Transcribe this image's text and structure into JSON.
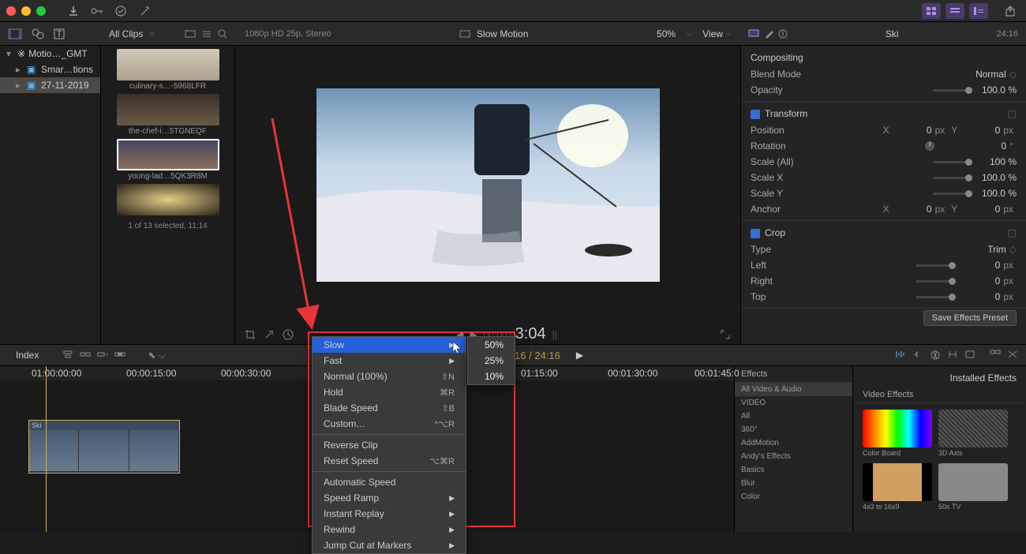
{
  "toolbar": {
    "import": "↓",
    "keyword": "⌁",
    "share": "⤴"
  },
  "browser_header": {
    "dropdown": "All Clips",
    "format": "1080p HD 25p, Stereo"
  },
  "viewer": {
    "title": "Slow Motion",
    "zoom": "50%",
    "view": "View",
    "time_display": "00:00:03;04",
    "time_goto": "3:04"
  },
  "inspector": {
    "title": "Ski",
    "duration": "24:16",
    "sections": {
      "compositing": "Compositing",
      "blend_mode_label": "Blend Mode",
      "blend_mode_value": "Normal",
      "opacity_label": "Opacity",
      "opacity_value": "100.0 %",
      "transform": "Transform",
      "position_label": "Position",
      "position_x": "0",
      "position_y": "0",
      "rotation_label": "Rotation",
      "rotation_value": "0",
      "scale_all_label": "Scale (All)",
      "scale_all_value": "100 %",
      "scale_x_label": "Scale X",
      "scale_x_value": "100.0 %",
      "scale_y_label": "Scale Y",
      "scale_y_value": "100.0 %",
      "anchor_label": "Anchor",
      "anchor_x": "0",
      "anchor_y": "0",
      "crop": "Crop",
      "type_label": "Type",
      "type_value": "Trim",
      "left_label": "Left",
      "left_value": "0",
      "right_label": "Right",
      "right_value": "0",
      "top_label": "Top",
      "top_value": "0",
      "px": "px",
      "deg": "°",
      "x_label": "X",
      "y_label": "Y"
    },
    "save_preset": "Save Effects Preset"
  },
  "tree": {
    "item1": "Motio…_GMT",
    "item2": "Smar…tions",
    "item3": "27-11-2019"
  },
  "clips": {
    "c1": "culinary-s…-5968LFR",
    "c2": "the-chef-i…5TGNEQF",
    "c3": "young-lad…5QK3R8M",
    "footer": "1 of 13 selected, 11;14"
  },
  "timeline": {
    "index": "Index",
    "time": "24:16 / 24:16",
    "marks": [
      "01:00:00:00",
      "00:00:15:00",
      "00:00:30:00",
      "01:15:00",
      "00:01:30:00",
      "00:01:45:0"
    ],
    "clip_name": "Ski"
  },
  "effects": {
    "title": "Effects",
    "installed": "Installed Effects",
    "header": "All Video & Audio",
    "cat1": "VIDEO",
    "cat2": "All",
    "cat3": "360°",
    "cat4": "AddMotion",
    "cat5": "Andy's Effects",
    "cat6": "Basics",
    "cat7": "Blur",
    "cat8": "Color",
    "section_title": "Video Effects",
    "fx1": "Color Board",
    "fx2": "3D Axis",
    "fx3": "4x3 to 16x9",
    "fx4": "50s TV"
  },
  "menu": {
    "slow": "Slow",
    "fast": "Fast",
    "normal": "Normal (100%)",
    "normal_sc": "⇧N",
    "hold": "Hold",
    "hold_sc": "⌘R",
    "blade": "Blade Speed",
    "blade_sc": "⇧B",
    "custom": "Custom…",
    "custom_sc": "^⌥R",
    "reverse": "Reverse Clip",
    "reset": "Reset Speed",
    "reset_sc": "⌥⌘R",
    "auto": "Automatic Speed",
    "ramp": "Speed Ramp",
    "replay": "Instant Replay",
    "rewind": "Rewind",
    "jump": "Jump Cut at Markers"
  },
  "submenu": {
    "p50": "50%",
    "p25": "25%",
    "p10": "10%"
  }
}
